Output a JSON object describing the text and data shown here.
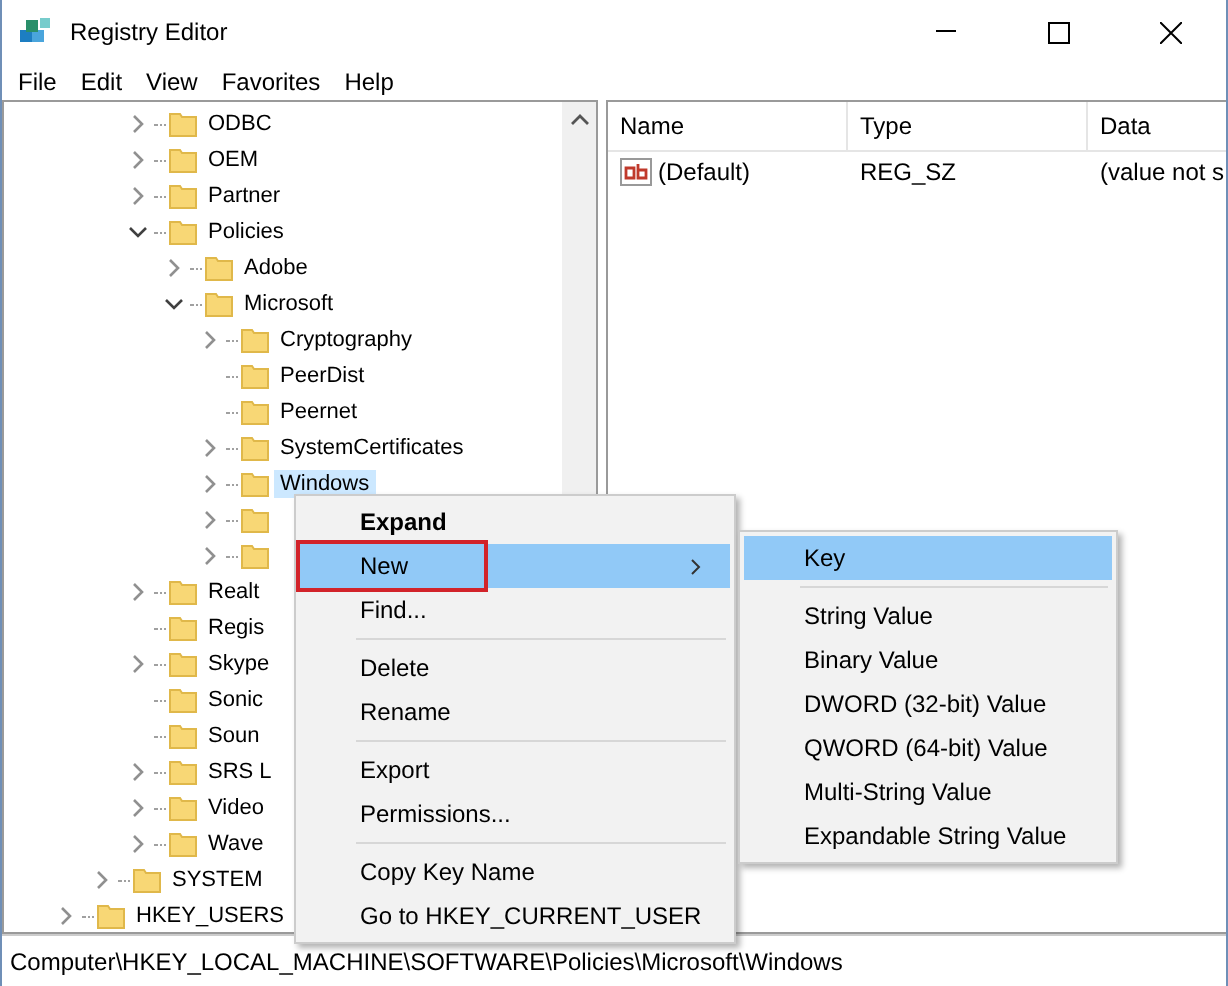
{
  "window": {
    "title": "Registry Editor"
  },
  "menu_bar": [
    "File",
    "Edit",
    "View",
    "Favorites",
    "Help"
  ],
  "tree": [
    {
      "kind": "offscreen",
      "children": [
        {
          "kind": "offscreen",
          "children": [
            {
              "kind": "offscreen",
              "children": [
                {
                  "kind": "branch",
                  "label": "ODBC",
                  "expanded": false,
                  "selected": false
                },
                {
                  "kind": "branch",
                  "label": "OEM",
                  "expanded": false,
                  "selected": false
                },
                {
                  "kind": "branch",
                  "label": "Partner",
                  "expanded": false,
                  "selected": false
                },
                {
                  "kind": "branch",
                  "label": "Policies",
                  "expanded": true,
                  "selected": false,
                  "children": [
                    {
                      "kind": "branch",
                      "label": "Adobe",
                      "expanded": false,
                      "selected": false
                    },
                    {
                      "kind": "branch",
                      "label": "Microsoft",
                      "expanded": true,
                      "selected": false,
                      "children": [
                        {
                          "kind": "branch",
                          "label": "Cryptography",
                          "expanded": false,
                          "selected": false
                        },
                        {
                          "kind": "leaf",
                          "label": "PeerDist",
                          "selected": false
                        },
                        {
                          "kind": "leaf",
                          "label": "Peernet",
                          "selected": false
                        },
                        {
                          "kind": "branch",
                          "label": "SystemCertificates",
                          "expanded": false,
                          "selected": false
                        },
                        {
                          "kind": "branch",
                          "label": "Windows",
                          "expanded": false,
                          "selected": true
                        },
                        {
                          "kind": "branch",
                          "expanded": false,
                          "selected": false
                        },
                        {
                          "kind": "branch",
                          "expanded": false,
                          "selected": false
                        }
                      ]
                    }
                  ]
                },
                {
                  "kind": "branch",
                  "label": "Realt",
                  "expanded": false,
                  "selected": false
                },
                {
                  "kind": "leaf",
                  "label": "Regis",
                  "selected": false
                },
                {
                  "kind": "branch",
                  "label": "Skype",
                  "expanded": false,
                  "selected": false
                },
                {
                  "kind": "leaf",
                  "label": "Sonic",
                  "selected": false
                },
                {
                  "kind": "leaf",
                  "label": "Soun",
                  "selected": false
                },
                {
                  "kind": "branch",
                  "label": "SRS L",
                  "expanded": false,
                  "selected": false
                },
                {
                  "kind": "branch",
                  "label": "Video",
                  "expanded": false,
                  "selected": false
                },
                {
                  "kind": "branch",
                  "label": "Wave",
                  "expanded": false,
                  "selected": false
                }
              ]
            },
            {
              "kind": "branch",
              "label": "SYSTEM",
              "expanded": false,
              "selected": false
            }
          ]
        },
        {
          "kind": "branch",
          "label": "HKEY_USERS",
          "expanded": false,
          "selected": false
        }
      ]
    }
  ],
  "values_list": {
    "columns": [
      "Name",
      "Type",
      "Data"
    ],
    "rows": [
      {
        "name": "(Default)",
        "type": "REG_SZ",
        "data": "(value not s"
      }
    ]
  },
  "context_menu": [
    {
      "kind": "default",
      "label": "Expand",
      "selected": false
    },
    {
      "kind": "submenu",
      "label": "New",
      "selected": true,
      "framed": true
    },
    {
      "kind": "item",
      "label": "Find...",
      "selected": false
    },
    {
      "kind": "separator"
    },
    {
      "kind": "item",
      "label": "Delete",
      "selected": false
    },
    {
      "kind": "item",
      "label": "Rename",
      "selected": false
    },
    {
      "kind": "separator"
    },
    {
      "kind": "item",
      "label": "Export",
      "selected": false
    },
    {
      "kind": "item",
      "label": "Permissions...",
      "selected": false
    },
    {
      "kind": "separator"
    },
    {
      "kind": "item",
      "label": "Copy Key Name",
      "selected": false
    },
    {
      "kind": "item",
      "label": "Go to HKEY_CURRENT_USER",
      "selected": false
    }
  ],
  "submenu": [
    {
      "kind": "item",
      "label": "Key",
      "selected": true
    },
    {
      "kind": "separator"
    },
    {
      "kind": "item",
      "label": "String Value",
      "selected": false
    },
    {
      "kind": "item",
      "label": "Binary Value",
      "selected": false
    },
    {
      "kind": "item",
      "label": "DWORD (32-bit) Value",
      "selected": false
    },
    {
      "kind": "item",
      "label": "QWORD (64-bit) Value",
      "selected": false
    },
    {
      "kind": "item",
      "label": "Multi-String Value",
      "selected": false
    },
    {
      "kind": "item",
      "label": "Expandable String Value",
      "selected": false
    }
  ],
  "status_bar": "Computer\\HKEY_LOCAL_MACHINE\\SOFTWARE\\Policies\\Microsoft\\Windows"
}
